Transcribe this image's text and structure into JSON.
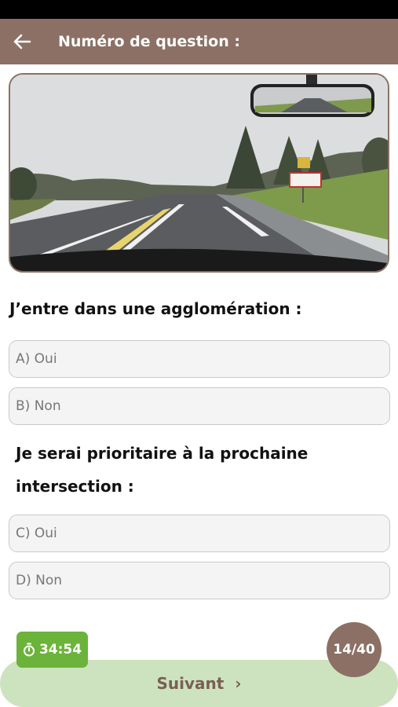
{
  "header": {
    "title": "Numéro de question :",
    "back_icon": "arrow-left-icon",
    "background": "#8c7065"
  },
  "photo": {
    "description_icon": "road-scene-image"
  },
  "question1": {
    "text": "J’entre dans une agglomération :",
    "answers": [
      {
        "label": "A) Oui"
      },
      {
        "label": "B) Non"
      }
    ]
  },
  "question2": {
    "text": "Je serai prioritaire à la prochaine intersection :",
    "answers": [
      {
        "label": "C) Oui"
      },
      {
        "label": "D) Non"
      }
    ]
  },
  "footer": {
    "timer": "34:54",
    "timer_icon": "stopwatch-icon",
    "progress": "14/40",
    "next_label": "Suivant",
    "next_icon": "chevron-right-icon",
    "colors": {
      "timer": "#6bb33a",
      "next": "#cde3bf",
      "counter": "#8c7065"
    }
  }
}
